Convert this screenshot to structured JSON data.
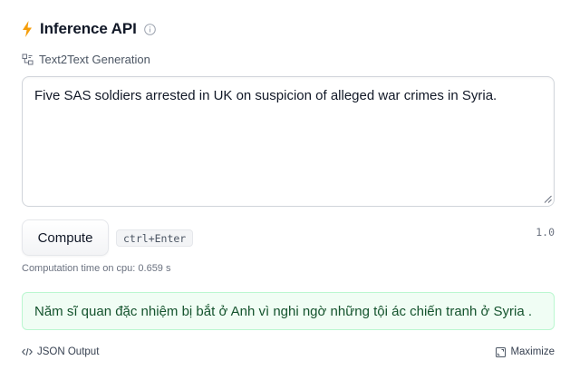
{
  "header": {
    "title": "Inference API",
    "icon": "lightning-bolt-icon",
    "accent_color": "#f59e0b"
  },
  "task": {
    "label": "Text2Text Generation",
    "icon": "task-icon"
  },
  "input": {
    "value": "Five SAS soldiers arrested in UK on suspicion of alleged war crimes in Syria."
  },
  "actions": {
    "compute_label": "Compute",
    "shortcut": "ctrl+Enter",
    "version": "1.0"
  },
  "computation": {
    "time_text": "Computation time on cpu: 0.659 s"
  },
  "output": {
    "text": "Năm sĩ quan đặc nhiệm bị bắt ở Anh vì nghi ngờ những tội ác chiến tranh ở Syria ."
  },
  "footer": {
    "json_label": "JSON Output",
    "maximize_label": "Maximize"
  }
}
